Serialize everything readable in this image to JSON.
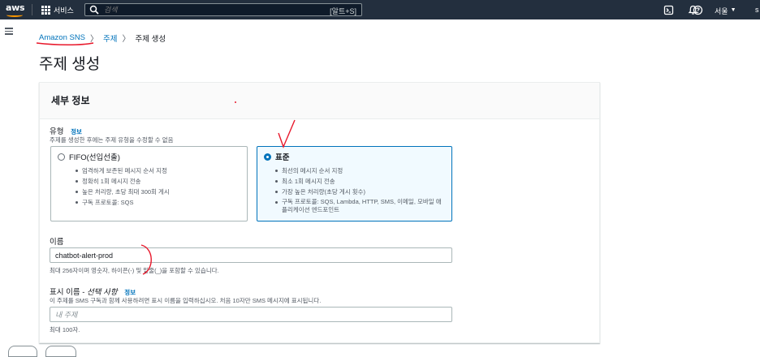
{
  "topbar": {
    "logo_text": "aws",
    "services_label": "서비스",
    "search_placeholder": "검색",
    "search_shortcut": "[알트+S]",
    "region_label": "서울",
    "region_caret": "▼",
    "account_label": "s"
  },
  "breadcrumb": {
    "items": [
      "Amazon SNS",
      "주제",
      "주제 생성"
    ],
    "separator": "〉"
  },
  "page": {
    "title": "주제 생성"
  },
  "details": {
    "header": "세부 정보",
    "type": {
      "label": "유형",
      "info": "정보",
      "description": "주제를 생성한 후에는 주제 유형을 수정할 수 없음",
      "options": [
        {
          "title": "FIFO(선입선출)",
          "selected": false,
          "bullets": [
            "엄격하게 보존된 메시지 순서 지정",
            "정확히 1회 메시지 전송",
            "높은 처리량, 초당 최대 300회 게시",
            "구독 프로토콜: SQS"
          ]
        },
        {
          "title": "표준",
          "selected": true,
          "bullets": [
            "최선의 메시지 순서 지정",
            "최소 1회 메시지 전송",
            "가장 높은 처리량(초당 게시 횟수)",
            "구독 프로토콜: SQS, Lambda, HTTP, SMS, 이메일, 모바일 애플리케이션 엔드포인트"
          ]
        }
      ]
    },
    "name": {
      "label": "이름",
      "value": "chatbot-alert-prod",
      "hint": "최대 256자이며 영숫자, 하이픈(-) 및 밑줄(_)을 포함할 수 있습니다."
    },
    "display_name": {
      "label": "표시 이름 - ",
      "optional": "선택 사항",
      "info": "정보",
      "description": "이 주제를 SMS 구독과 함께 사용하려면 표시 이름을 입력하십시오. 처음 10자만 SMS 메시지에 표시됩니다.",
      "placeholder": "내 주제",
      "hint": "최대 100자."
    }
  },
  "colors": {
    "topbar": "#232f3e",
    "link": "#0073bb",
    "selected_tile_bg": "#f1faff",
    "annotation_red": "#e8182b"
  }
}
